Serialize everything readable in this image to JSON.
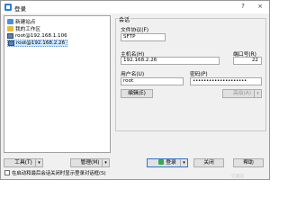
{
  "window": {
    "title": "登录",
    "controls": {
      "help": "?",
      "close": "×"
    }
  },
  "tree": {
    "items": [
      {
        "label": "新建站点",
        "icon": "new-site-icon",
        "selected": false
      },
      {
        "label": "我的工作区",
        "icon": "folder-icon",
        "selected": false
      },
      {
        "label": "root@192.168.1.106",
        "icon": "server-icon",
        "selected": false
      },
      {
        "label": "root@192.168.2.26",
        "icon": "server-icon",
        "selected": true
      }
    ]
  },
  "session": {
    "group_label": "会话",
    "protocol": {
      "label": "文件协议(F)",
      "value": "SFTP"
    },
    "host": {
      "label": "主机名(H)",
      "value": "192.168.2.26"
    },
    "port": {
      "label": "端口号(R)",
      "value": "22"
    },
    "user": {
      "label": "用户名(U)",
      "value": "root"
    },
    "password": {
      "label": "密码(P)",
      "value": "••••••••••••••••••••"
    },
    "edit_button": "编辑(E)",
    "advanced_button": "高级(A)"
  },
  "footer": {
    "tools_button": "工具(T)",
    "manage_button": "管理(M)",
    "login_button": "登录",
    "close_button": "关闭",
    "help_button": "帮助",
    "startup_checkbox": "在启动和最后会话关闭时显示登录对话框(S)",
    "watermark": "亿速云"
  },
  "colors": {
    "selection": "#cce8ff",
    "primary_border": "#2f74d0",
    "login_icon": "#3aa84a"
  }
}
